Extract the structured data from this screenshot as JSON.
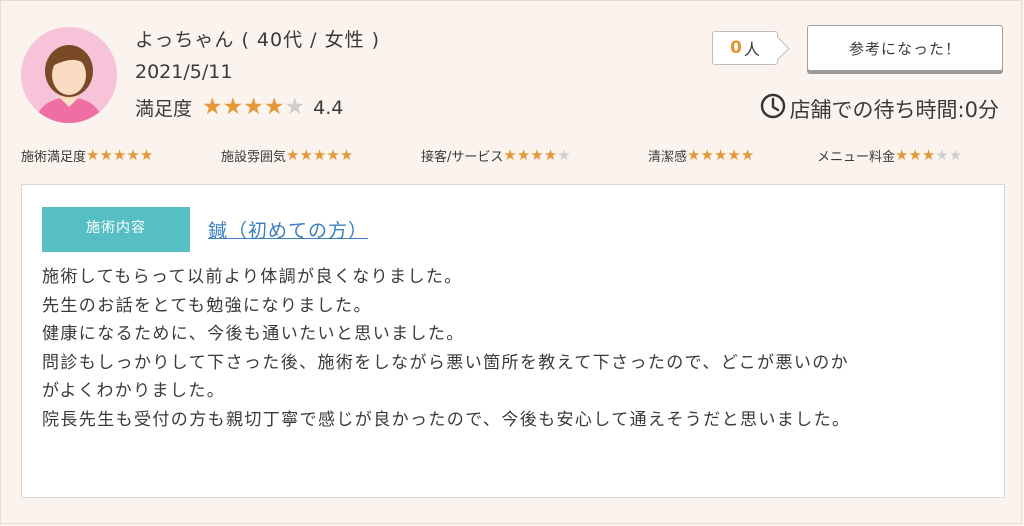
{
  "reviewer": {
    "name": "よっちゃん ( 40代 / 女性 )",
    "date": "2021/5/11",
    "satisfaction_label": "満足度",
    "satisfaction_stars": 4.4,
    "satisfaction_score": "4.4"
  },
  "helpful": {
    "count": "0",
    "count_unit": "人",
    "button_label": "参考になった！"
  },
  "wait_time": {
    "icon": "clock-icon",
    "text": "店舗での待ち時間:0分"
  },
  "ratings": [
    {
      "label": "施術満足度",
      "stars": 5
    },
    {
      "label": "施設雰囲気",
      "stars": 5
    },
    {
      "label": "接客/サービス",
      "stars": 4
    },
    {
      "label": "清潔感",
      "stars": 5
    },
    {
      "label": "メニュー料金",
      "stars": 3
    }
  ],
  "review": {
    "tag_label": "施術内容",
    "treatment": "鍼（初めての方）",
    "lines": [
      "施術してもらって以前より体調が良くなりました。",
      "先生のお話をとても勉強になりました。",
      "健康になるために、今後も通いたいと思いました。",
      "問診もしっかりして下さった後、施術をしながら悪い箇所を教えて下さったので、どこが悪いのか",
      "がよくわかりました。",
      "院長先生も受付の方も親切丁寧で感じが良かったので、今後も安心して通えそうだと思いました。"
    ]
  },
  "colors": {
    "star_filled": "#e5983a",
    "star_empty": "#cfcfcf",
    "tag_bg": "#56bfc4",
    "link": "#3b7fc0",
    "count_accent": "#e8922e",
    "avatar_bg": "#f7c3d9"
  }
}
